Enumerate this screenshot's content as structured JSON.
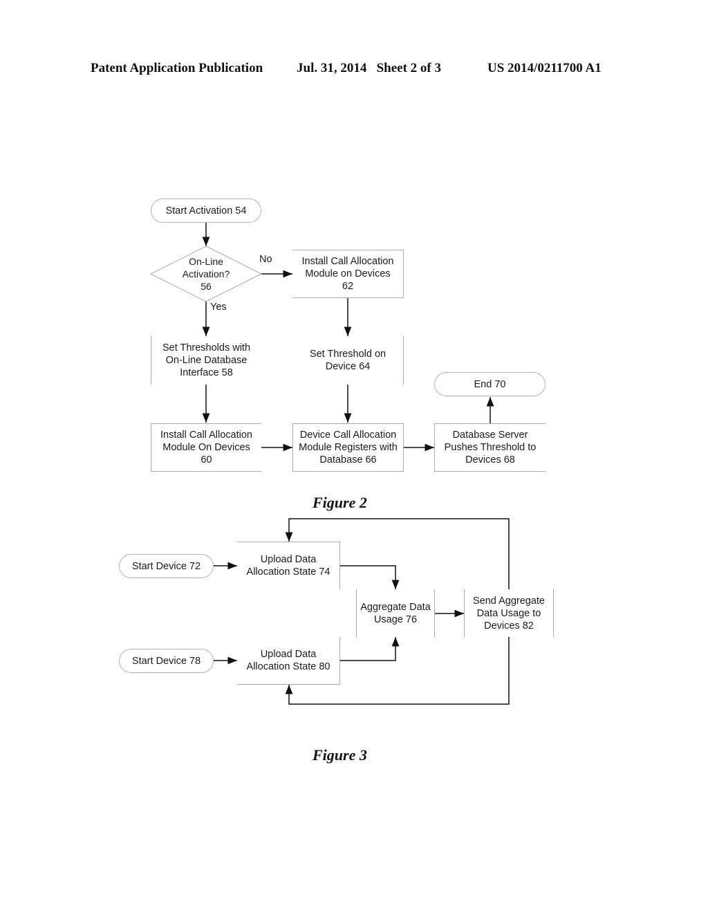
{
  "header": {
    "publication": "Patent Application Publication",
    "date_sheet": "Jul. 31, 2014   Sheet 2 of 3",
    "number": "US 2014/0211700 A1"
  },
  "figure2": {
    "caption": "Figure 2",
    "nodes": {
      "n54": "Start Activation 54",
      "n56": "On-Line\nActivation?\n56",
      "n62": "Install Call Allocation\nModule on Devices\n62",
      "n58": "Set Thresholds with\nOn-Line Database\nInterface  58",
      "n64": "Set Threshold on\nDevice 64",
      "n70": "End  70",
      "n60": "Install Call Allocation\nModule On Devices\n60",
      "n66": "Device Call Allocation\nModule Registers with\nDatabase  66",
      "n68": "Database Server\nPushes Threshold to\nDevices  68"
    },
    "labels": {
      "no": "No",
      "yes": "Yes"
    }
  },
  "figure3": {
    "caption": "Figure 3",
    "nodes": {
      "n72": "Start Device 72",
      "n74": "Upload Data\nAllocation State  74",
      "n76": "Aggregate Data\nUsage  76",
      "n82": "Send Aggregate\nData Usage to\nDevices  82",
      "n78": "Start Device 78",
      "n80": "Upload Data\nAllocation State  80"
    }
  }
}
